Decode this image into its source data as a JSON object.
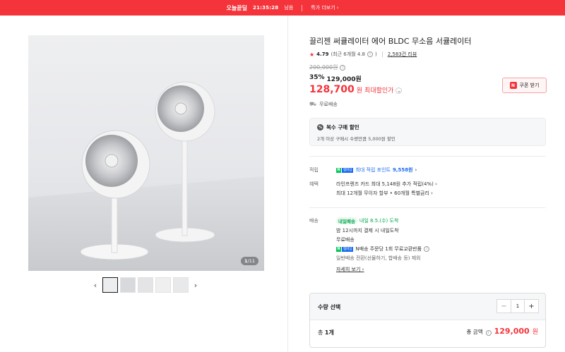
{
  "topbar": {
    "badge": "오늘끝딜",
    "timer": "21:35:28",
    "remaining": "남음",
    "more": "특가 더보기",
    "bg": "#f4333b"
  },
  "gallery": {
    "counter_current": "1",
    "counter_total": "/11",
    "prev": "‹",
    "next": "›"
  },
  "product": {
    "title": "끌리젠 써큘레이터 에어 BLDC 무소음 서큘레이터",
    "rating": "4.79",
    "rating_recent": "(최근 6개월 4.8",
    "rating_close": ")",
    "review_count": "2,583건 리뷰",
    "original_price": "200,000원",
    "discount_rate": "35%",
    "sale_price": "129,000원",
    "best_price": "128,700",
    "best_unit": "원",
    "best_label": "최대할인가",
    "coupon_label": "쿠폰 받기",
    "shipping_tag": "무료배송"
  },
  "multi_purchase": {
    "title": "복수 구매 할인",
    "desc": "2개 이상 구매시 수량만큼 5,000원 할인"
  },
  "benefits": {
    "point_label": "적립",
    "npay_n": "N",
    "npay_text": "멤버십",
    "point_text": "최대 적립 포인트",
    "point_value": "9,558원",
    "benefit_label": "혜택",
    "benefit_line1": "라인프렌즈 카드 최대 5,148원 추가 적립(4%)",
    "benefit_line2": "최대 12개월 무이자 할부 • 60개월 특별금리"
  },
  "delivery": {
    "label": "배송",
    "tomorrow_badge": "내일배송",
    "tomorrow_date": "내일 8.5.(수) 도착",
    "cutoff": "밤 12시까지 결제 시 내일도착",
    "free": "무료배송",
    "npay_text": "N배송 주문당 1회 무료교환반품",
    "general": "일반배송 전환(선물하기, 합배송 등) 제외",
    "detail_link": "자세히 보기"
  },
  "quantity": {
    "title": "수량 선택",
    "minus": "−",
    "value": "1",
    "plus": "+",
    "total_count_label": "총",
    "total_count": "1개",
    "total_price_label": "총 금액",
    "total_price": "129,000",
    "total_unit": "원"
  },
  "colors": {
    "accent": "#f4333b",
    "npay_green": "#03c75a",
    "blue": "#1e6cf0"
  }
}
